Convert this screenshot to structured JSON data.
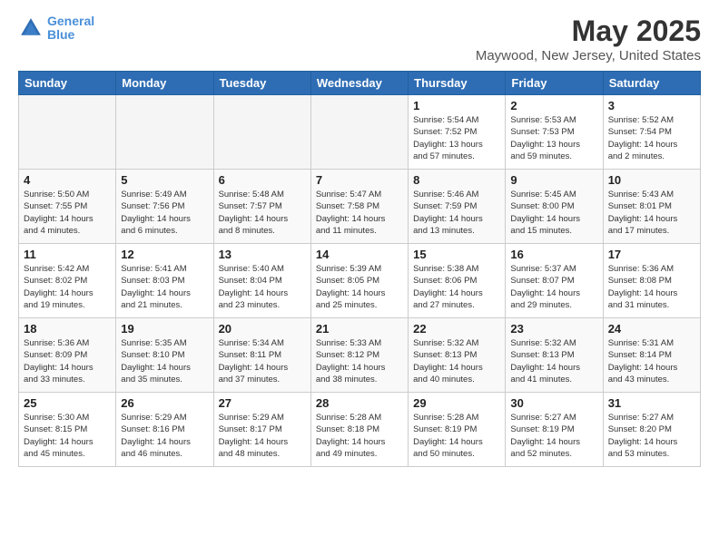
{
  "header": {
    "logo_line1": "General",
    "logo_line2": "Blue",
    "main_title": "May 2025",
    "subtitle": "Maywood, New Jersey, United States"
  },
  "days_of_week": [
    "Sunday",
    "Monday",
    "Tuesday",
    "Wednesday",
    "Thursday",
    "Friday",
    "Saturday"
  ],
  "weeks": [
    [
      {
        "day": "",
        "empty": true
      },
      {
        "day": "",
        "empty": true
      },
      {
        "day": "",
        "empty": true
      },
      {
        "day": "",
        "empty": true
      },
      {
        "day": "1",
        "info": "Sunrise: 5:54 AM\nSunset: 7:52 PM\nDaylight: 13 hours\nand 57 minutes."
      },
      {
        "day": "2",
        "info": "Sunrise: 5:53 AM\nSunset: 7:53 PM\nDaylight: 13 hours\nand 59 minutes."
      },
      {
        "day": "3",
        "info": "Sunrise: 5:52 AM\nSunset: 7:54 PM\nDaylight: 14 hours\nand 2 minutes."
      }
    ],
    [
      {
        "day": "4",
        "info": "Sunrise: 5:50 AM\nSunset: 7:55 PM\nDaylight: 14 hours\nand 4 minutes."
      },
      {
        "day": "5",
        "info": "Sunrise: 5:49 AM\nSunset: 7:56 PM\nDaylight: 14 hours\nand 6 minutes."
      },
      {
        "day": "6",
        "info": "Sunrise: 5:48 AM\nSunset: 7:57 PM\nDaylight: 14 hours\nand 8 minutes."
      },
      {
        "day": "7",
        "info": "Sunrise: 5:47 AM\nSunset: 7:58 PM\nDaylight: 14 hours\nand 11 minutes."
      },
      {
        "day": "8",
        "info": "Sunrise: 5:46 AM\nSunset: 7:59 PM\nDaylight: 14 hours\nand 13 minutes."
      },
      {
        "day": "9",
        "info": "Sunrise: 5:45 AM\nSunset: 8:00 PM\nDaylight: 14 hours\nand 15 minutes."
      },
      {
        "day": "10",
        "info": "Sunrise: 5:43 AM\nSunset: 8:01 PM\nDaylight: 14 hours\nand 17 minutes."
      }
    ],
    [
      {
        "day": "11",
        "info": "Sunrise: 5:42 AM\nSunset: 8:02 PM\nDaylight: 14 hours\nand 19 minutes."
      },
      {
        "day": "12",
        "info": "Sunrise: 5:41 AM\nSunset: 8:03 PM\nDaylight: 14 hours\nand 21 minutes."
      },
      {
        "day": "13",
        "info": "Sunrise: 5:40 AM\nSunset: 8:04 PM\nDaylight: 14 hours\nand 23 minutes."
      },
      {
        "day": "14",
        "info": "Sunrise: 5:39 AM\nSunset: 8:05 PM\nDaylight: 14 hours\nand 25 minutes."
      },
      {
        "day": "15",
        "info": "Sunrise: 5:38 AM\nSunset: 8:06 PM\nDaylight: 14 hours\nand 27 minutes."
      },
      {
        "day": "16",
        "info": "Sunrise: 5:37 AM\nSunset: 8:07 PM\nDaylight: 14 hours\nand 29 minutes."
      },
      {
        "day": "17",
        "info": "Sunrise: 5:36 AM\nSunset: 8:08 PM\nDaylight: 14 hours\nand 31 minutes."
      }
    ],
    [
      {
        "day": "18",
        "info": "Sunrise: 5:36 AM\nSunset: 8:09 PM\nDaylight: 14 hours\nand 33 minutes."
      },
      {
        "day": "19",
        "info": "Sunrise: 5:35 AM\nSunset: 8:10 PM\nDaylight: 14 hours\nand 35 minutes."
      },
      {
        "day": "20",
        "info": "Sunrise: 5:34 AM\nSunset: 8:11 PM\nDaylight: 14 hours\nand 37 minutes."
      },
      {
        "day": "21",
        "info": "Sunrise: 5:33 AM\nSunset: 8:12 PM\nDaylight: 14 hours\nand 38 minutes."
      },
      {
        "day": "22",
        "info": "Sunrise: 5:32 AM\nSunset: 8:13 PM\nDaylight: 14 hours\nand 40 minutes."
      },
      {
        "day": "23",
        "info": "Sunrise: 5:32 AM\nSunset: 8:13 PM\nDaylight: 14 hours\nand 41 minutes."
      },
      {
        "day": "24",
        "info": "Sunrise: 5:31 AM\nSunset: 8:14 PM\nDaylight: 14 hours\nand 43 minutes."
      }
    ],
    [
      {
        "day": "25",
        "info": "Sunrise: 5:30 AM\nSunset: 8:15 PM\nDaylight: 14 hours\nand 45 minutes."
      },
      {
        "day": "26",
        "info": "Sunrise: 5:29 AM\nSunset: 8:16 PM\nDaylight: 14 hours\nand 46 minutes."
      },
      {
        "day": "27",
        "info": "Sunrise: 5:29 AM\nSunset: 8:17 PM\nDaylight: 14 hours\nand 48 minutes."
      },
      {
        "day": "28",
        "info": "Sunrise: 5:28 AM\nSunset: 8:18 PM\nDaylight: 14 hours\nand 49 minutes."
      },
      {
        "day": "29",
        "info": "Sunrise: 5:28 AM\nSunset: 8:19 PM\nDaylight: 14 hours\nand 50 minutes."
      },
      {
        "day": "30",
        "info": "Sunrise: 5:27 AM\nSunset: 8:19 PM\nDaylight: 14 hours\nand 52 minutes."
      },
      {
        "day": "31",
        "info": "Sunrise: 5:27 AM\nSunset: 8:20 PM\nDaylight: 14 hours\nand 53 minutes."
      }
    ]
  ]
}
